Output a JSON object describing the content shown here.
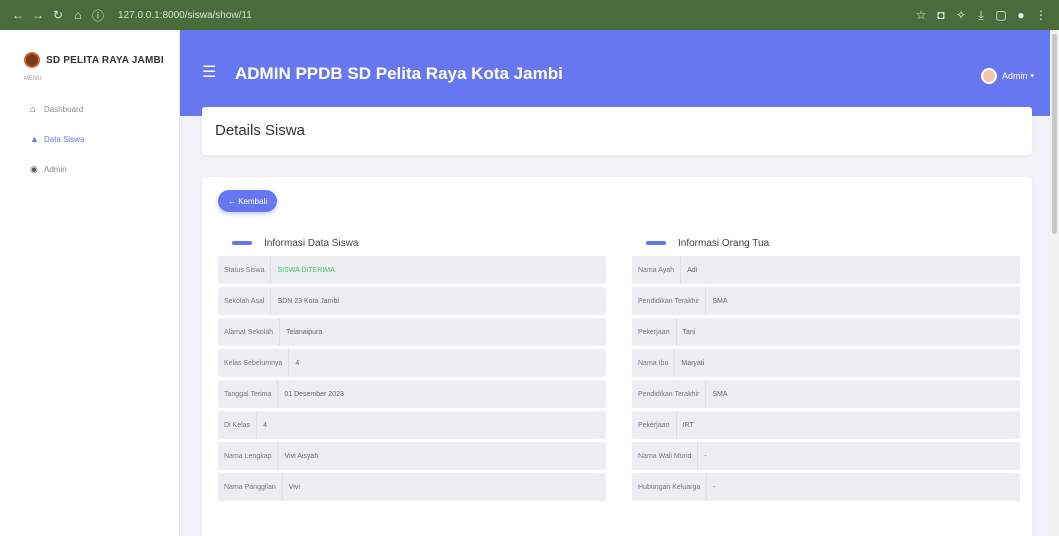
{
  "browser": {
    "url": "127.0.0.1:8000/siswa/show/11"
  },
  "sidebar": {
    "brand": "SD PELITA RAYA JAMBI",
    "section": "MENU",
    "items": [
      {
        "label": "Dashboard",
        "icon": "home-icon"
      },
      {
        "label": "Data Siswa",
        "icon": "user-icon",
        "active": true
      },
      {
        "label": "Admin",
        "icon": "eye-icon"
      }
    ]
  },
  "header": {
    "title": "ADMIN PPDB SD Pelita Raya Kota Jambi",
    "user": "Admin"
  },
  "page": {
    "heading": "Details Siswa",
    "back_label": "← Kembali"
  },
  "left": {
    "title": "Informasi Data Siswa",
    "rows": [
      {
        "label": "Status Siswa",
        "value": "SISWA DITERIMA"
      },
      {
        "label": "Sekolah Asal",
        "value": "SDN 23 Kota Jambi"
      },
      {
        "label": "Alamat Sekolah",
        "value": "Telanaipura"
      },
      {
        "label": "Kelas Sebelumnya",
        "value": "4"
      },
      {
        "label": "Tanggal Terima",
        "value": "01 Desember 2023"
      },
      {
        "label": "Di Kelas",
        "value": "4"
      },
      {
        "label": "Nama Lengkap",
        "value": "Vivi Aisyah"
      },
      {
        "label": "Nama Panggilan",
        "value": "Vivi"
      }
    ]
  },
  "right": {
    "title": "Informasi Orang Tua",
    "rows": [
      {
        "label": "Nama Ayah",
        "value": "Adi"
      },
      {
        "label": "Pendidikan Terakhir",
        "value": "SMA"
      },
      {
        "label": "Pekerjaan",
        "value": "Tani"
      },
      {
        "label": "Nama Ibu",
        "value": "Maryati"
      },
      {
        "label": "Pendidikan Terakhir",
        "value": "SMA"
      },
      {
        "label": "Pekerjaan",
        "value": "IRT"
      },
      {
        "label": "Nama Wali Murid",
        "value": "-"
      },
      {
        "label": "Hubungan Keluarga",
        "value": "-"
      }
    ]
  },
  "colors": {
    "accent": "#6777ef",
    "success": "#47c363",
    "browser_bar": "#4a6b3a"
  }
}
